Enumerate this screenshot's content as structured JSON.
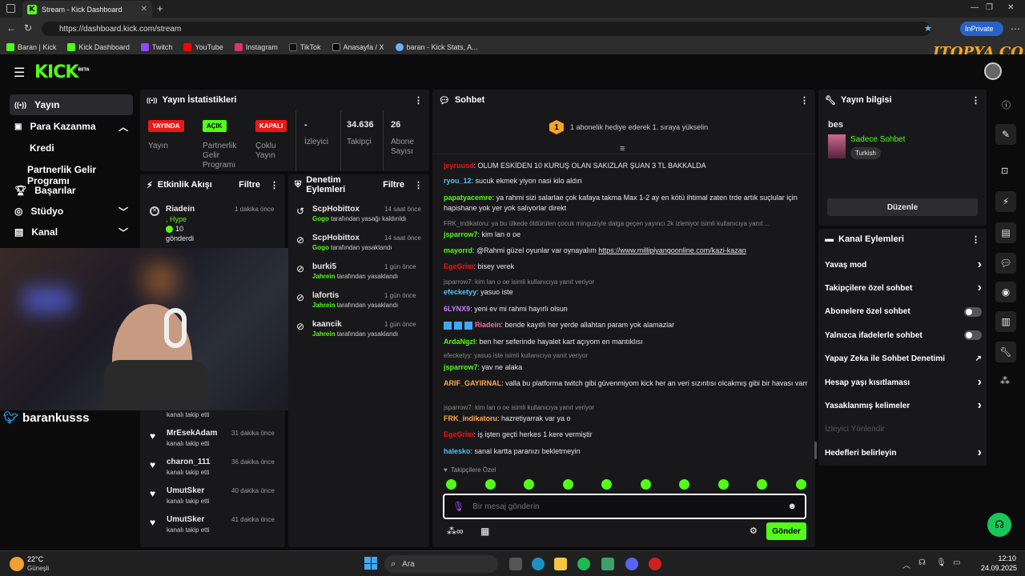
{
  "browser": {
    "tab_title": "Stream - Kick Dashboard",
    "url": "https://dashboard.kick.com/stream",
    "inprivate": "InPrivate",
    "bookmarks": [
      "Baran | Kick",
      "Kick Dashboard",
      "Twitch",
      "YouTube",
      "Instagram",
      "TikTok",
      "Anasayfa / X",
      "baran - Kick Stats, A..."
    ]
  },
  "watermark": "ITOPYA.COM",
  "logo": {
    "text": "KICK",
    "beta": "BETA"
  },
  "sidebar": {
    "items": [
      {
        "label": "Yayın",
        "icon": "broadcast-icon"
      },
      {
        "label": "Para Kazanma",
        "icon": "money-icon"
      },
      {
        "label": "Kredi"
      },
      {
        "label": "Partnerlik Gelir Programı"
      },
      {
        "label": "Başarılar",
        "icon": "trophy-icon"
      },
      {
        "label": "Stüdyo",
        "icon": "studio-icon"
      },
      {
        "label": "Kanal",
        "icon": "channel-icon"
      }
    ]
  },
  "stats": {
    "title": "Yayın İstatistikleri",
    "cells": [
      {
        "badge": "YAYINDA",
        "label": "Yayın",
        "color": "#e91916"
      },
      {
        "badge": "AÇIK",
        "label": "Partnerlik Gelir Programı",
        "color": "#53fc18"
      },
      {
        "badge": "KAPALI",
        "label": "Çoklu Yayın",
        "color": "#e91916"
      },
      {
        "value": "-",
        "label": "İzleyici"
      },
      {
        "value": "34.636",
        "label": "Takipçi"
      },
      {
        "value": "26",
        "label": "Abone Sayısı"
      }
    ]
  },
  "activity": {
    "title": "Etkinlik Akışı",
    "filter": "Filtre",
    "gift": {
      "name": "Riadein",
      "sub": ", Hype",
      "amount": "10",
      "action": "gönderdi",
      "time": "1 dakika önce"
    },
    "follows": [
      {
        "name": "MrEsekAdam",
        "action": "kanalı takip etti",
        "time": "31 dakika önce"
      },
      {
        "name": "charon_111",
        "action": "kanalı takip etti",
        "time": "36 dakika önce"
      },
      {
        "name": "UmutSker",
        "action": "kanalı takip etti",
        "time": "40 dakika önce"
      },
      {
        "name": "UmutSker",
        "action": "kanalı takip etti",
        "time": "41 dakika önce"
      }
    ],
    "partial": "kanalı takip etti"
  },
  "moderation": {
    "title": "Denetim Eylemleri",
    "filter": "Filtre",
    "items": [
      {
        "user": "ScpHobittox",
        "mod": "Gogo",
        "action": "tarafından yasağı kaldırıldı",
        "time": "14 saat önce"
      },
      {
        "user": "ScpHobittox",
        "mod": "Gogo",
        "action": "tarafından yasaklandı",
        "time": "14 saat önce"
      },
      {
        "user": "burki5",
        "mod": "Jahrein",
        "action": "tarafından yasaklandı",
        "time": "1 gün önce"
      },
      {
        "user": "lafortis",
        "mod": "Jahrein",
        "action": "tarafından yasaklandı",
        "time": "1 gün önce"
      },
      {
        "user": "kaancik",
        "mod": "Jahrein",
        "action": "tarafından yasaklandı",
        "time": "1 gün önce"
      }
    ]
  },
  "webcam_overlay": "barankusss",
  "chat": {
    "title": "Sohbet",
    "banner": "1 abonelik hediye ederek 1. sıraya yükselin",
    "banner_num": "1",
    "messages": [
      {
        "user": "jeyruusd",
        "color": "#e91916",
        "text": "OLUM ESKİDEN 10 KURUŞ OLAN SAKIZLAR ŞUAN 3 TL BAKKALDA"
      },
      {
        "user": "ryou_12",
        "color": "#4fc3f7",
        "text": "sucuk ekmek yiyon nasi kilo aldın"
      },
      {
        "user": "papatyacemre",
        "color": "#53fc18",
        "text": "ya rahmi sizi salarlae çok kafaya takma Max 1-2 ay en kötü ihtimal zaten trde artık suçlular için hapishane yok yer yok salıyorlar direkt"
      },
      {
        "reply": "FRK_indikatoru: ya bu ülkede öldürülen çocuk minguziyle dalga geçen yayıncı 2k izleniyor isimli kullanıcıya yanıt ..."
      },
      {
        "user": "jsparrow7",
        "color": "#53fc18",
        "text": "kim lan o oe"
      },
      {
        "user": "mayorrd",
        "color": "#53fc18",
        "text": "@Rahmi güzel oyunlar var oynayalım ",
        "link": "https://www.millipiyangoonline.com/kazi-kazan"
      },
      {
        "user": "EgeGrim",
        "color": "#e91916",
        "text": "bisey verek"
      },
      {
        "reply": "jsparrow7: kim lan o oe isimli kullanıcıya yanıt veriyor"
      },
      {
        "user": "efecketyy",
        "color": "#4fc3f7",
        "text": "yasuo iste"
      },
      {
        "user": "6LYNX9",
        "color": "#c77dff",
        "text": "yeni ev mi rahmi hayırlı olsun"
      },
      {
        "user": "Riadein",
        "color": "#ff6b9d",
        "text": "bende kayıtlı her yerde allahtan param yok alamazlar"
      },
      {
        "user": "ArdaNgzl",
        "color": "#53fc18",
        "text": "ben her seferinde hayalet kart açıyom en mantıklısı"
      },
      {
        "reply": "efecketyy: yasuo iste isimli kullanıcıya yanıt veriyor"
      },
      {
        "user": "jsparrow7",
        "color": "#53fc18",
        "text": "yav ne alaka"
      },
      {
        "user": "ARIF_GAYIRNAL",
        "color": "#ffa94d",
        "text": "valla bu platforma twitch gibi güvenmiyom kick her an veri sızıntısı olcakmış gibi bir havası varr"
      },
      {
        "reply": "jsparrow7: kim lan o oe isimli kullanıcıya yanıt veriyor"
      },
      {
        "user": "FRK_indikatoru",
        "color": "#ffa94d",
        "text": "hazretiyarrak var ya o"
      },
      {
        "user": "EgeGrim",
        "color": "#e91916",
        "text": "iş işten geçti herkes 1 kere vermiştir"
      },
      {
        "user": "halesko",
        "color": "#4fc3f7",
        "text": "sanal kartta paranızı bekletmeyin"
      }
    ],
    "followers_only": "Takipçilere Özel",
    "placeholder": "Bir mesaj gönderin",
    "send": "Gönder"
  },
  "stream_info": {
    "title": "Yayın bilgisi",
    "stream_title": "bes",
    "category": "Sadece Sohbet",
    "tag": "Turkish",
    "edit": "Düzenle"
  },
  "channel_actions": {
    "title": "Kanal Eylemleri",
    "items": [
      {
        "label": "Yavaş mod",
        "type": "chevron"
      },
      {
        "label": "Takipçilere özel sohbet",
        "type": "chevron"
      },
      {
        "label": "Abonelere özel sohbet",
        "type": "toggle"
      },
      {
        "label": "Yalnızca ifadelerle sohbet",
        "type": "toggle"
      },
      {
        "label": "Yapay Zeka ile Sohbet Denetimi",
        "type": "external"
      },
      {
        "label": "Hesap yaşı kısıtlaması",
        "type": "chevron"
      },
      {
        "label": "Yasaklanmış kelimeler",
        "type": "chevron"
      },
      {
        "label": "İzleyici Yönlendir",
        "type": "disabled"
      },
      {
        "label": "Hedefleri belirleyin",
        "type": "chevron"
      }
    ]
  },
  "taskbar": {
    "weather_temp": "22°C",
    "weather_desc": "Güneşli",
    "search": "Ara",
    "time": "12:10",
    "date": "24.09.2025"
  }
}
